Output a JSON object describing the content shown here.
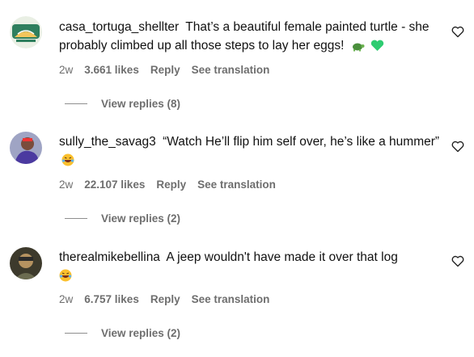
{
  "comments": [
    {
      "username": "casa_tortuga_shellter",
      "text": "That’s a beautiful female painted turtle - she probably climbed up all those steps to lay her eggs!",
      "emojis": [
        "turtle-emoji",
        "green-heart-emoji"
      ],
      "age": "2w",
      "likes": "3.661 likes",
      "reply_label": "Reply",
      "translation_label": "See translation",
      "replies_label": "View replies (8)"
    },
    {
      "username": "sully_the_savag3",
      "text": "“Watch He’ll flip him self over, he’s like a hummer”",
      "emojis": [
        "laughing-emoji"
      ],
      "age": "2w",
      "likes": "22.107 likes",
      "reply_label": "Reply",
      "translation_label": "See translation",
      "replies_label": "View replies (2)"
    },
    {
      "username": "therealmikebellina",
      "text": "A jeep wouldn't have made it over that log",
      "emojis": [
        "laughing-emoji"
      ],
      "age": "2w",
      "likes": "6.757 likes",
      "reply_label": "Reply",
      "translation_label": "See translation",
      "replies_label": "View replies (2)"
    }
  ],
  "avatar_0_logo_text": "CASA TORTUGA",
  "colors": {
    "text": "#111111",
    "secondary": "#6e6e6e",
    "green_heart": "#2ecc71"
  }
}
